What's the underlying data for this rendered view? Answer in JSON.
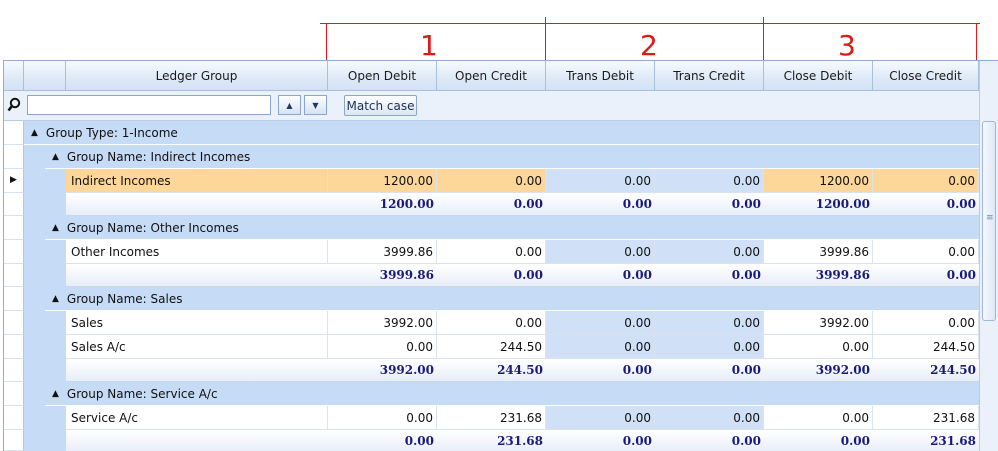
{
  "annotations": {
    "labels": [
      "1",
      "2",
      "3"
    ],
    "color": "#e01818"
  },
  "columns": {
    "ledger_group": "Ledger Group",
    "open_debit": "Open Debit",
    "open_credit": "Open Credit",
    "trans_debit": "Trans Debit",
    "trans_credit": "Trans Credit",
    "close_debit": "Close Debit",
    "close_credit": "Close Credit"
  },
  "filter": {
    "value": "",
    "up_icon": "triangle-up-icon",
    "down_icon": "triangle-down-icon",
    "match_case_label": "Match case"
  },
  "group_type": "Group Type: 1-Income",
  "groups": [
    {
      "header": "Group Name: Indirect Incomes",
      "rows": [
        {
          "name": "Indirect Incomes",
          "open_debit": "1200.00",
          "open_credit": "0.00",
          "trans_debit": "0.00",
          "trans_credit": "0.00",
          "close_debit": "1200.00",
          "close_credit": "0.00",
          "selected": true
        }
      ],
      "summary": {
        "open_debit": "1200.00",
        "open_credit": "0.00",
        "trans_debit": "0.00",
        "trans_credit": "0.00",
        "close_debit": "1200.00",
        "close_credit": "0.00"
      }
    },
    {
      "header": "Group Name: Other Incomes",
      "rows": [
        {
          "name": "Other Incomes",
          "open_debit": "3999.86",
          "open_credit": "0.00",
          "trans_debit": "0.00",
          "trans_credit": "0.00",
          "close_debit": "3999.86",
          "close_credit": "0.00"
        }
      ],
      "summary": {
        "open_debit": "3999.86",
        "open_credit": "0.00",
        "trans_debit": "0.00",
        "trans_credit": "0.00",
        "close_debit": "3999.86",
        "close_credit": "0.00"
      }
    },
    {
      "header": "Group Name: Sales",
      "rows": [
        {
          "name": "Sales",
          "open_debit": "3992.00",
          "open_credit": "0.00",
          "trans_debit": "0.00",
          "trans_credit": "0.00",
          "close_debit": "3992.00",
          "close_credit": "0.00"
        },
        {
          "name": "Sales A/c",
          "open_debit": "0.00",
          "open_credit": "244.50",
          "trans_debit": "0.00",
          "trans_credit": "0.00",
          "close_debit": "0.00",
          "close_credit": "244.50"
        }
      ],
      "summary": {
        "open_debit": "3992.00",
        "open_credit": "244.50",
        "trans_debit": "0.00",
        "trans_credit": "0.00",
        "close_debit": "3992.00",
        "close_credit": "244.50"
      }
    },
    {
      "header": "Group Name: Service A/c",
      "rows": [
        {
          "name": "Service A/c",
          "open_debit": "0.00",
          "open_credit": "231.68",
          "trans_debit": "0.00",
          "trans_credit": "0.00",
          "close_debit": "0.00",
          "close_credit": "231.68"
        }
      ],
      "summary": {
        "open_debit": "0.00",
        "open_credit": "231.68",
        "trans_debit": "0.00",
        "trans_credit": "0.00",
        "close_debit": "0.00",
        "close_credit": "231.68"
      }
    }
  ],
  "colors": {
    "selected_row": "#fdd69a",
    "group_band": "#c6dbf6",
    "trans_column": "#cfe0f7",
    "summary_text": "#1a1a7a"
  }
}
